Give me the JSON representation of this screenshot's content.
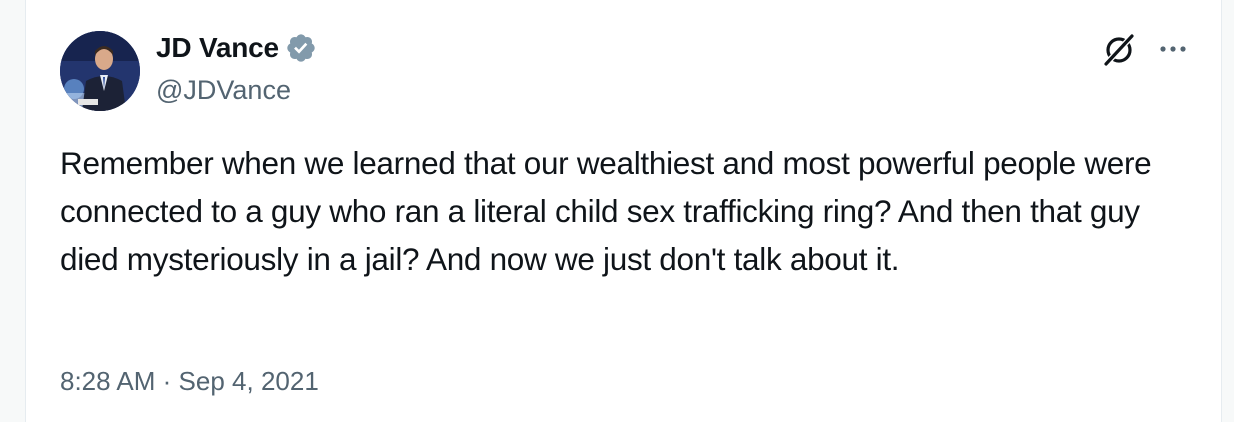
{
  "author": {
    "display_name": "JD Vance",
    "handle": "@JDVance",
    "verified": true,
    "avatar_icon": "profile-photo"
  },
  "tweet": {
    "text": "Remember when we learned that our wealthiest and most powerful people were connected to a guy who ran a literal child sex trafficking ring? And then that guy died mysteriously in a jail? And now we just don't talk about it."
  },
  "meta": {
    "time": "8:28 AM",
    "separator": "·",
    "date": "Sep 4, 2021"
  },
  "icons": {
    "grok": "grok-icon",
    "more": "more-options-icon"
  },
  "colors": {
    "verified_badge": "#829aab",
    "text_primary": "#0f1419",
    "text_secondary": "#536471"
  }
}
